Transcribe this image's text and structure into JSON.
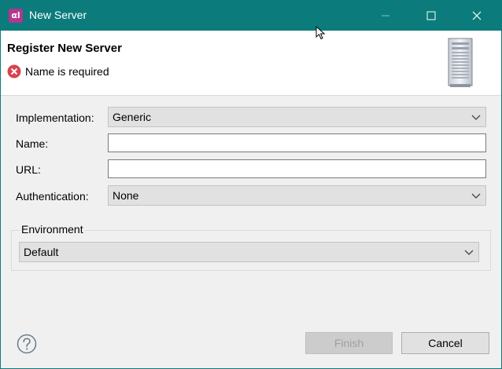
{
  "window": {
    "title": "New Server",
    "app_icon_text": "αl",
    "controls": [
      "minimize-icon",
      "maximize-icon",
      "close-icon"
    ]
  },
  "header": {
    "title": "Register New Server",
    "message": "Name is required",
    "message_icon": "error-icon",
    "banner_icon": "server-icon"
  },
  "form": {
    "implementation": {
      "label": "Implementation:",
      "value": "Generic"
    },
    "name": {
      "label": "Name:",
      "value": ""
    },
    "url": {
      "label": "URL:",
      "value": ""
    },
    "authentication": {
      "label": "Authentication:",
      "value": "None"
    }
  },
  "environment": {
    "label": "Environment",
    "value": "Default"
  },
  "footer": {
    "help_icon": "help-icon",
    "finish_label": "Finish",
    "cancel_label": "Cancel"
  },
  "colors": {
    "titlebar": "#0c7b7b",
    "app_icon": "#b5358f",
    "error": "#d9434e"
  }
}
